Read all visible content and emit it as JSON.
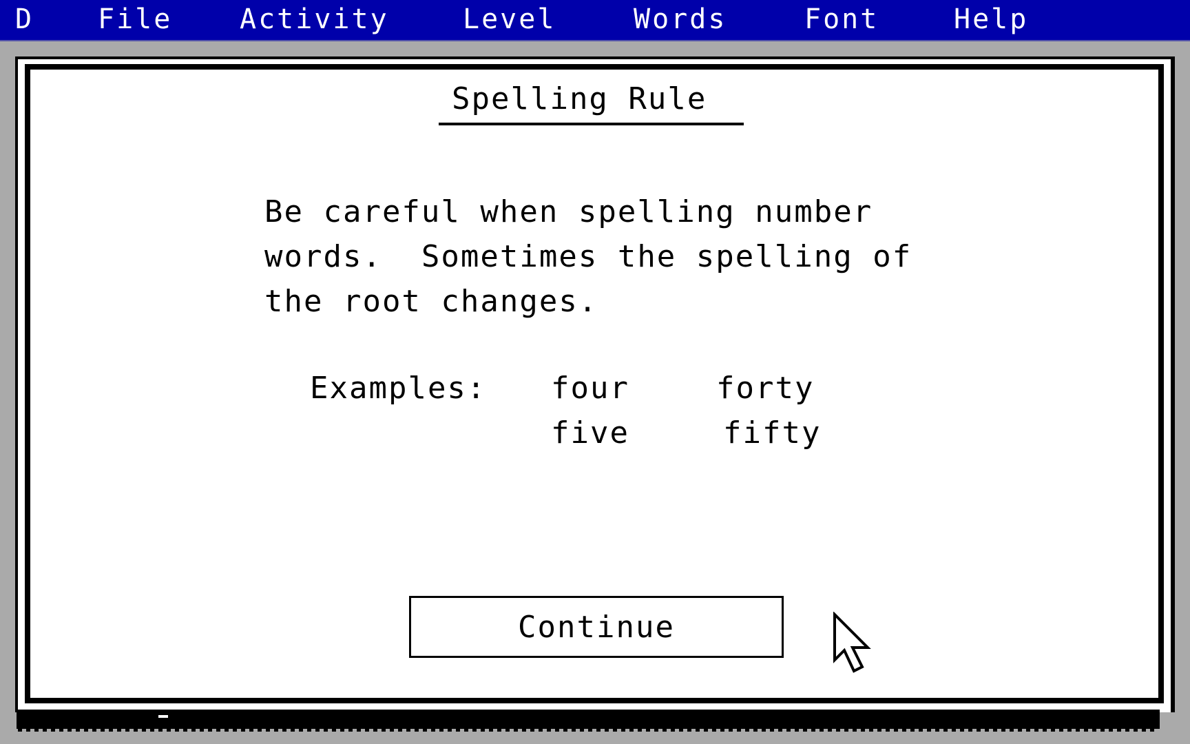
{
  "menubar": {
    "items": [
      {
        "label": "D"
      },
      {
        "label": "File"
      },
      {
        "label": "Activity"
      },
      {
        "label": "Level"
      },
      {
        "label": "Words"
      },
      {
        "label": "Font"
      },
      {
        "label": "Help"
      }
    ]
  },
  "dialog": {
    "title": "Spelling Rule",
    "rule_lines": [
      "Be careful when spelling number",
      "words.  Sometimes the spelling of",
      "the root changes."
    ],
    "examples_label": "Examples:",
    "examples": [
      {
        "root": "four",
        "derived": "forty"
      },
      {
        "root": "five",
        "derived": "fifty"
      }
    ],
    "continue_label": "Continue"
  },
  "colors": {
    "menubar_bg": "#0000aa",
    "menubar_text": "#ffffff",
    "desktop_bg": "#aaaaaa",
    "dialog_bg": "#ffffff",
    "ink": "#000000"
  },
  "cursor": {
    "icon": "arrow-pointer-icon"
  }
}
